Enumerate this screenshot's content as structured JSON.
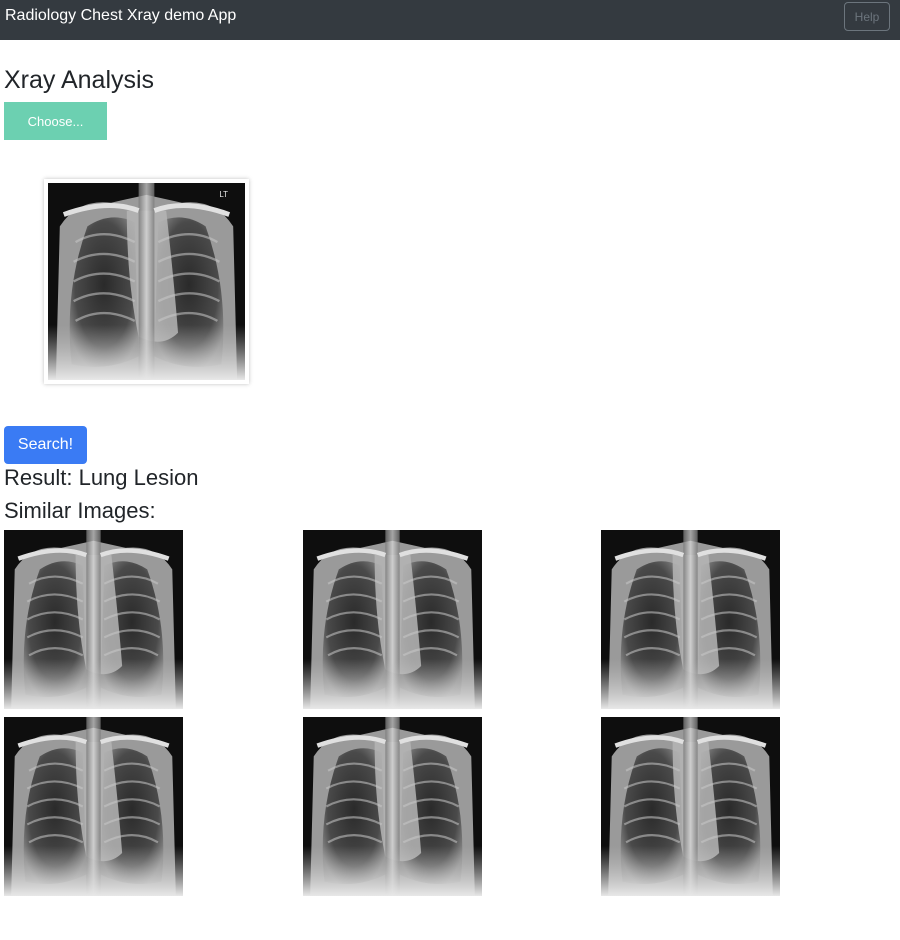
{
  "navbar": {
    "brand": "Radiology Chest Xray demo App",
    "help_label": "Help"
  },
  "main": {
    "title": "Xray Analysis",
    "choose_label": "Choose...",
    "preview": {
      "marker": "LT"
    },
    "search_label": "Search!",
    "result_text": "Result: Lung Lesion",
    "similar_title": "Similar Images:",
    "similar_images": [
      {
        "name": "similar-image-1",
        "icon": "chest-xray-image"
      },
      {
        "name": "similar-image-2",
        "icon": "chest-xray-image"
      },
      {
        "name": "similar-image-3",
        "icon": "chest-xray-image"
      },
      {
        "name": "similar-image-4",
        "icon": "chest-xray-image"
      },
      {
        "name": "similar-image-5",
        "icon": "chest-xray-image"
      },
      {
        "name": "similar-image-6",
        "icon": "chest-xray-image"
      }
    ]
  },
  "colors": {
    "navbar_bg": "#343a40",
    "choose_button": "#6cd0b1",
    "search_button": "#3a7bf4",
    "help_border": "#6c757d"
  }
}
